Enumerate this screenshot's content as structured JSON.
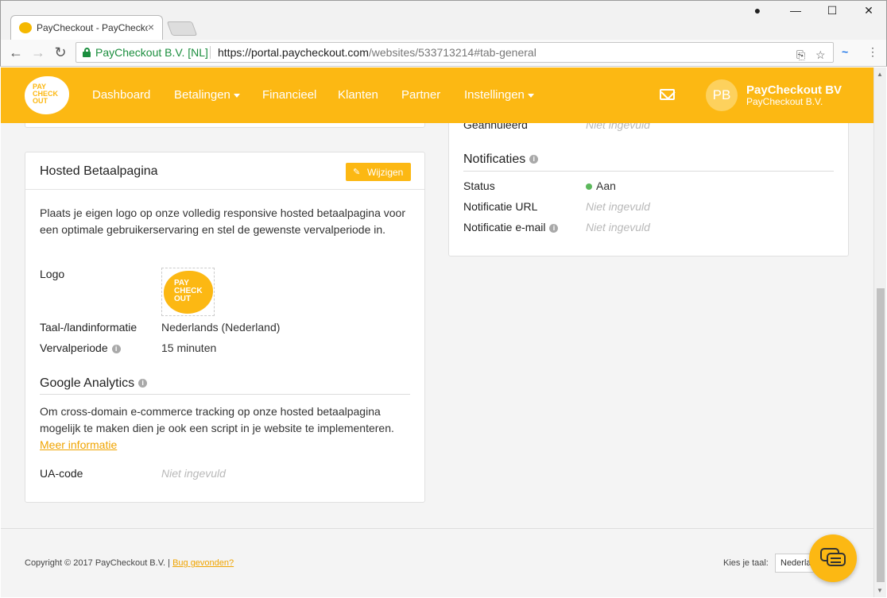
{
  "browser": {
    "tab_title": "PayCheckout - PayCheckout",
    "tab_close": "×",
    "win_user_icon": "account-icon",
    "win_minimize": "—",
    "win_maximize": "☐",
    "win_close": "✕",
    "back": "←",
    "forward": "→",
    "reload": "↻",
    "secure_label": "PayCheckout B.V. [NL]",
    "url_base": "https://portal.paycheckout.com",
    "url_path": "/websites/533713214#tab-general",
    "translate_icon": "⎘",
    "star_icon": "☆",
    "ext_icon": "~",
    "menu_icon": "⋮"
  },
  "header": {
    "logo_text_1": "PAY",
    "logo_text_2": "CHECK",
    "logo_text_3": "OUT",
    "nav": [
      {
        "label": "Dashboard"
      },
      {
        "label": "Betalingen"
      },
      {
        "label": "Financieel"
      },
      {
        "label": "Klanten"
      },
      {
        "label": "Partner"
      },
      {
        "label": "Instellingen"
      }
    ],
    "avatar_initials": "PB",
    "user_name": "PayCheckout BV",
    "user_company": "PayCheckout B.V."
  },
  "hosted": {
    "title": "Hosted Betaalpagina",
    "edit_label": "Wijzigen",
    "description": "Plaats je eigen logo op onze volledig responsive hosted betaalpagina voor een optimale gebruikerservaring en stel de gewenste vervalperiode in.",
    "logo_label": "Logo",
    "language_label": "Taal-/landinformatie",
    "language_value": "Nederlands (Nederland)",
    "expiry_label": "Vervalperiode",
    "expiry_value": "15 minuten"
  },
  "analytics": {
    "title": "Google Analytics",
    "description": "Om cross-domain e-commerce tracking op onze hosted betaalpagina mogelijk te maken dien je ook een script in je website te implementeren.",
    "more_info": "Meer informatie",
    "ua_label": "UA-code",
    "ua_value": "Niet ingevuld"
  },
  "right": {
    "cancelled_label": "Geannuleerd",
    "cancelled_value": "Niet ingevuld",
    "notifications_title": "Notificaties",
    "status_label": "Status",
    "status_value": "Aan",
    "status_color": "#5cb85c",
    "url_label": "Notificatie URL",
    "url_value": "Niet ingevuld",
    "email_label": "Notificatie e-mail",
    "email_value": "Niet ingevuld"
  },
  "footer": {
    "copyright": "Copyright © 2017 PayCheckout B.V. |",
    "bug_link": "Bug gevonden?",
    "lang_label": "Kies je taal:",
    "lang_value": "Nederlands"
  },
  "colors": {
    "brand": "#fcb813",
    "link": "#f0a400"
  }
}
